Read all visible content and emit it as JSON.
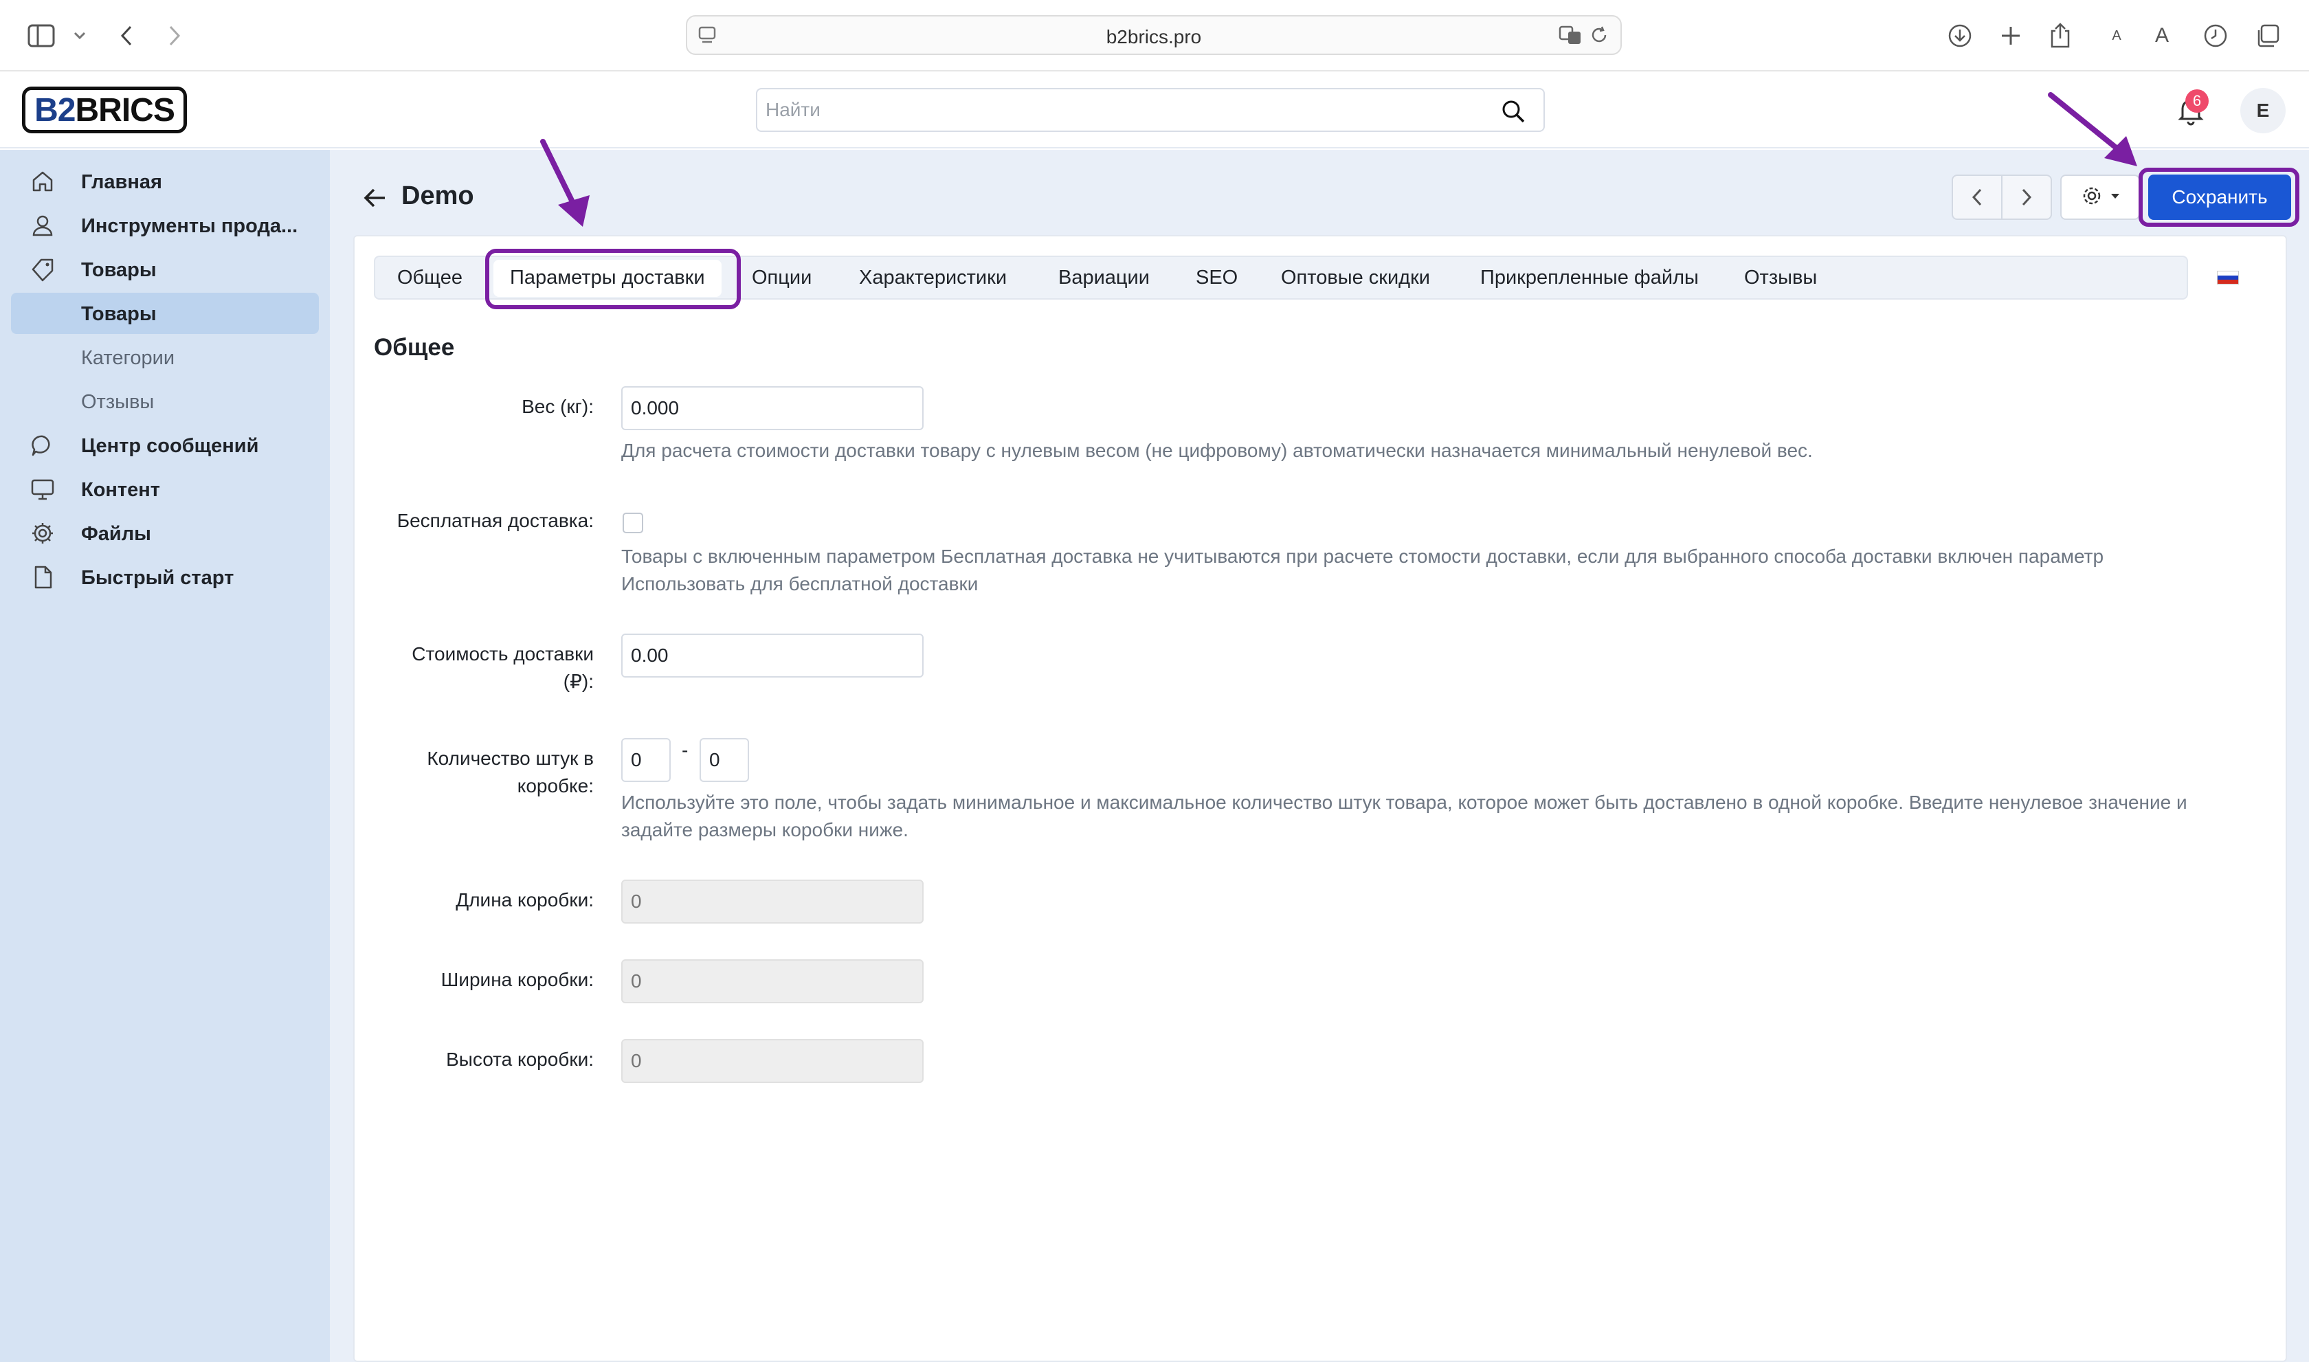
{
  "browser": {
    "url": "b2brics.pro"
  },
  "header": {
    "logo": {
      "part1": "B2",
      "part2": "BRICS"
    },
    "search_placeholder": "Найти",
    "notifications_count": "6",
    "avatar_letter": "E"
  },
  "sidebar": {
    "items": [
      {
        "label": "Главная",
        "icon": "home-icon"
      },
      {
        "label": "Инструменты прода...",
        "icon": "user-icon"
      },
      {
        "label": "Товары",
        "icon": "tag-icon"
      },
      {
        "label": "Товары"
      },
      {
        "label": "Категории"
      },
      {
        "label": "Отзывы"
      },
      {
        "label": "Центр сообщений",
        "icon": "chat-icon"
      },
      {
        "label": "Контент",
        "icon": "monitor-icon"
      },
      {
        "label": "Файлы",
        "icon": "gear-icon"
      },
      {
        "label": "Быстрый старт",
        "icon": "document-icon"
      }
    ]
  },
  "page": {
    "title": "Demo",
    "save_label": "Сохранить"
  },
  "tabs": [
    "Общее",
    "Параметры доставки",
    "Опции",
    "Характеристики",
    "Вариации",
    "SEO",
    "Оптовые скидки",
    "Прикрепленные файлы",
    "Отзывы"
  ],
  "form": {
    "section_title": "Общее",
    "weight": {
      "label": "Вес (кг):",
      "value": "0.000",
      "hint": "Для расчета стоимости доставки товару с нулевым весом (не цифровому) автоматически назначается минимальный ненулевой вес."
    },
    "free_shipping": {
      "label": "Бесплатная доставка:",
      "checked": false,
      "hint_line1": "Товары с включенным параметром Бесплатная доставка не учитываются при расчете стомости доставки, если для выбранного способа доставки включен параметр",
      "hint_line2": "Использовать для бесплатной доставки"
    },
    "shipping_cost": {
      "label_line1": "Стоимость доставки",
      "label_line2": "(₽):",
      "value": "0.00"
    },
    "box_qty": {
      "label_line1": "Количество штук в",
      "label_line2": "коробке:",
      "min": "0",
      "separator": "-",
      "max": "0",
      "hint_line1": "Используйте это поле, чтобы задать минимальное и максимальное количество штук товара, которое может быть доставлено в одной коробке. Введите ненулевое значение и",
      "hint_line2": "задайте размеры коробки ниже."
    },
    "box_length": {
      "label": "Длина коробки:",
      "placeholder": "0"
    },
    "box_width": {
      "label": "Ширина коробки:",
      "placeholder": "0"
    },
    "box_height": {
      "label": "Высота коробки:",
      "placeholder": "0"
    }
  },
  "colors": {
    "sidebar_bg": "#d6e3f3",
    "primary_button": "#1a57d4",
    "annotation": "#7a1fa2",
    "badge": "#ef4a6b"
  }
}
